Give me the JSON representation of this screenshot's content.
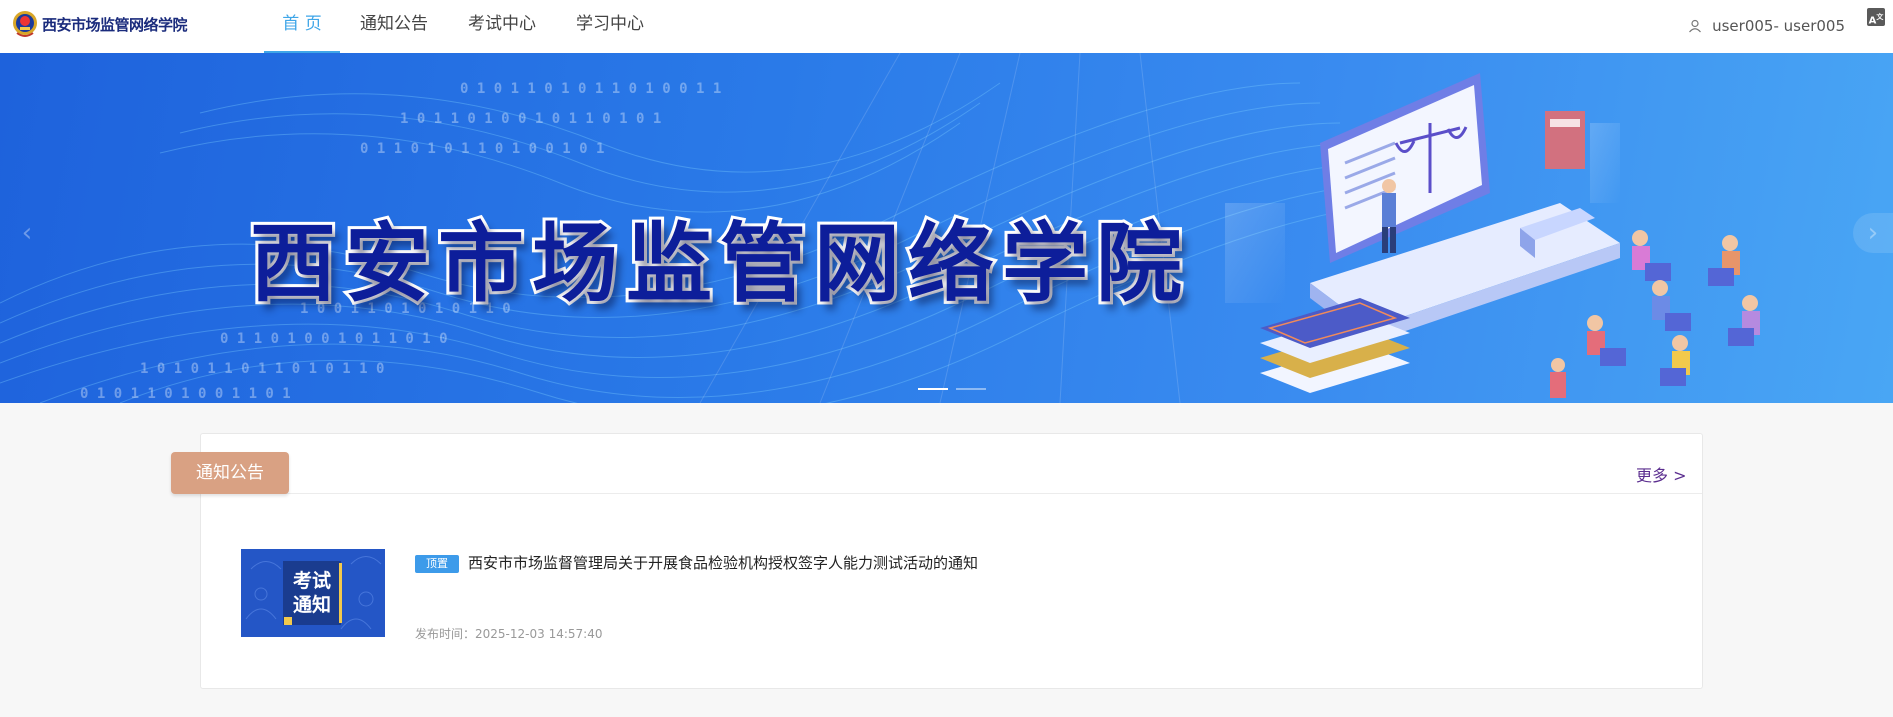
{
  "header": {
    "logo_text": "西安市场监管网络学院",
    "nav": [
      {
        "label": "首 页",
        "active": true
      },
      {
        "label": "通知公告",
        "active": false
      },
      {
        "label": "考试中心",
        "active": false
      },
      {
        "label": "学习中心",
        "active": false
      }
    ],
    "user_label": "user005- user005",
    "translate_icon": "translate-icon",
    "accent_color": "#3fa6e8"
  },
  "banner": {
    "title": "西安市场监管网络学院",
    "prev_icon": "chevron-left-icon",
    "next_icon": "chevron-right-icon",
    "slide_count": 2,
    "active_slide": 1
  },
  "notices": {
    "section_label": "通知公告",
    "more_label": "更多 >",
    "items": [
      {
        "thumb_text_line1": "考试",
        "thumb_text_line2": "通知",
        "badge": "顶置",
        "title": "西安市市场监督管理局关于开展食品检验机构授权签字人能力测试活动的通知",
        "time_label": "发布时间：",
        "time": "2025-12-03 14:57:40"
      }
    ]
  }
}
